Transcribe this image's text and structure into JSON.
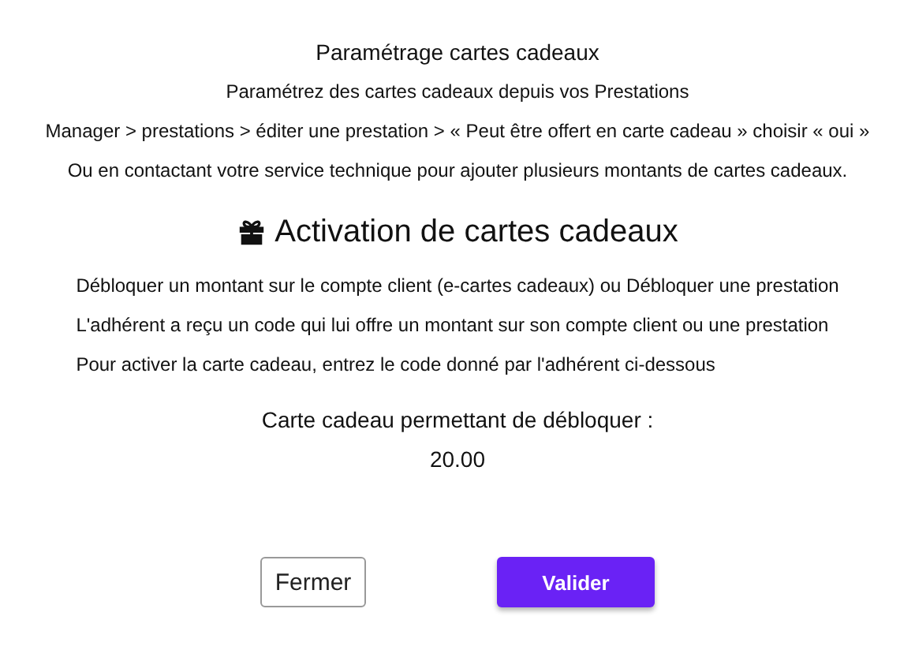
{
  "settings": {
    "title": "Paramétrage cartes cadeaux",
    "lines": [
      "Paramétrez des cartes cadeaux depuis vos Prestations",
      "Manager > prestations > éditer une prestation > « Peut être offert en carte cadeau » choisir « oui »",
      "Ou en contactant votre service technique pour ajouter plusieurs montants de cartes cadeaux."
    ]
  },
  "activation": {
    "title": "Activation de cartes cadeaux",
    "lines": [
      "Débloquer un montant sur le compte client (e-cartes cadeaux) ou Débloquer une prestation",
      "L'adhérent a reçu un code qui lui offre un montant sur son compte client ou une prestation",
      "Pour activer la carte cadeau, entrez le code donné par l'adhérent ci-dessous"
    ],
    "unlock_label": "Carte cadeau permettant de débloquer :",
    "amount": "20.00"
  },
  "buttons": [
    {
      "label": "Fermer",
      "kind": "secondary"
    },
    {
      "label": "Valider",
      "kind": "primary"
    }
  ]
}
